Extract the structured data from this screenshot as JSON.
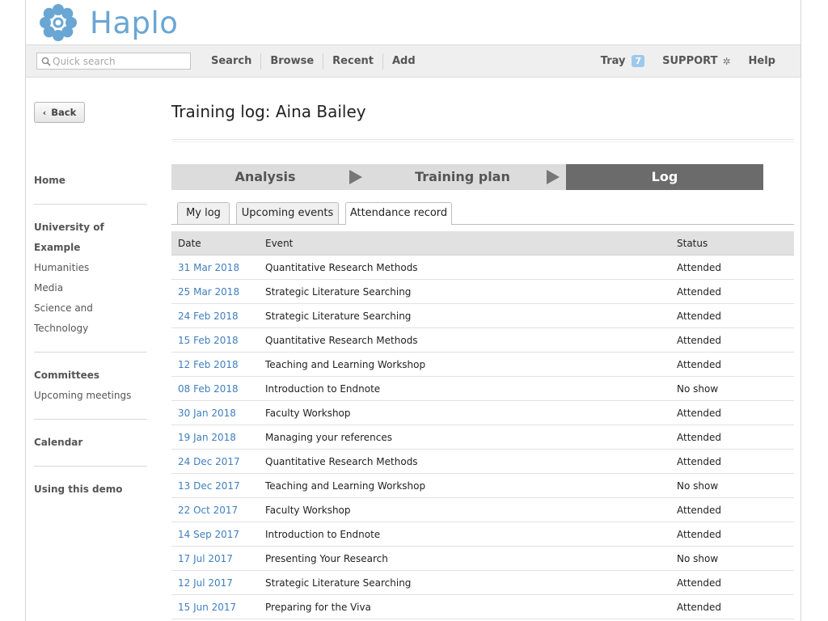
{
  "brand": {
    "name": "Haplo",
    "color": "#6aa6d4"
  },
  "search": {
    "placeholder": "Quick search"
  },
  "nav_main": [
    {
      "label": "Search"
    },
    {
      "label": "Browse"
    },
    {
      "label": "Recent"
    },
    {
      "label": "Add"
    }
  ],
  "nav_right": {
    "tray_label": "Tray",
    "tray_count": "7",
    "support_label": "SUPPORT",
    "help_label": "Help"
  },
  "sidebar": {
    "back_label": "Back",
    "home": "Home",
    "university": {
      "heading": "University of Example",
      "links": [
        "Humanities",
        "Media",
        "Science and Technology"
      ]
    },
    "committees": {
      "heading": "Committees",
      "links": [
        "Upcoming meetings"
      ]
    },
    "calendar": "Calendar",
    "demo": "Using this demo"
  },
  "page": {
    "title": "Training log: Aina Bailey"
  },
  "steps": [
    {
      "label": "Analysis",
      "active": false
    },
    {
      "label": "Training plan",
      "active": false
    },
    {
      "label": "Log",
      "active": true
    }
  ],
  "tabs": [
    {
      "label": "My log",
      "active": false
    },
    {
      "label": "Upcoming events",
      "active": false
    },
    {
      "label": "Attendance record",
      "active": true
    }
  ],
  "table": {
    "headers": {
      "date": "Date",
      "event": "Event",
      "status": "Status"
    },
    "rows": [
      {
        "date": "31 Mar 2018",
        "event": "Quantitative Research Methods",
        "status": "Attended"
      },
      {
        "date": "25 Mar 2018",
        "event": "Strategic Literature Searching",
        "status": "Attended"
      },
      {
        "date": "24 Feb 2018",
        "event": "Strategic Literature Searching",
        "status": "Attended"
      },
      {
        "date": "15 Feb 2018",
        "event": "Quantitative Research Methods",
        "status": "Attended"
      },
      {
        "date": "12 Feb 2018",
        "event": "Teaching and Learning Workshop",
        "status": "Attended"
      },
      {
        "date": "08 Feb 2018",
        "event": "Introduction to Endnote",
        "status": "No show"
      },
      {
        "date": "30 Jan 2018",
        "event": "Faculty Workshop",
        "status": "Attended"
      },
      {
        "date": "19 Jan 2018",
        "event": "Managing your references",
        "status": "Attended"
      },
      {
        "date": "24 Dec 2017",
        "event": "Quantitative Research Methods",
        "status": "Attended"
      },
      {
        "date": "13 Dec 2017",
        "event": "Teaching and Learning Workshop",
        "status": "No show"
      },
      {
        "date": "22 Oct 2017",
        "event": "Faculty Workshop",
        "status": "Attended"
      },
      {
        "date": "14 Sep 2017",
        "event": "Introduction to Endnote",
        "status": "Attended"
      },
      {
        "date": "17 Jul 2017",
        "event": "Presenting Your Research",
        "status": "No show"
      },
      {
        "date": "12 Jul 2017",
        "event": "Strategic Literature Searching",
        "status": "Attended"
      },
      {
        "date": "15 Jun 2017",
        "event": "Preparing for the Viva",
        "status": "Attended"
      }
    ]
  }
}
